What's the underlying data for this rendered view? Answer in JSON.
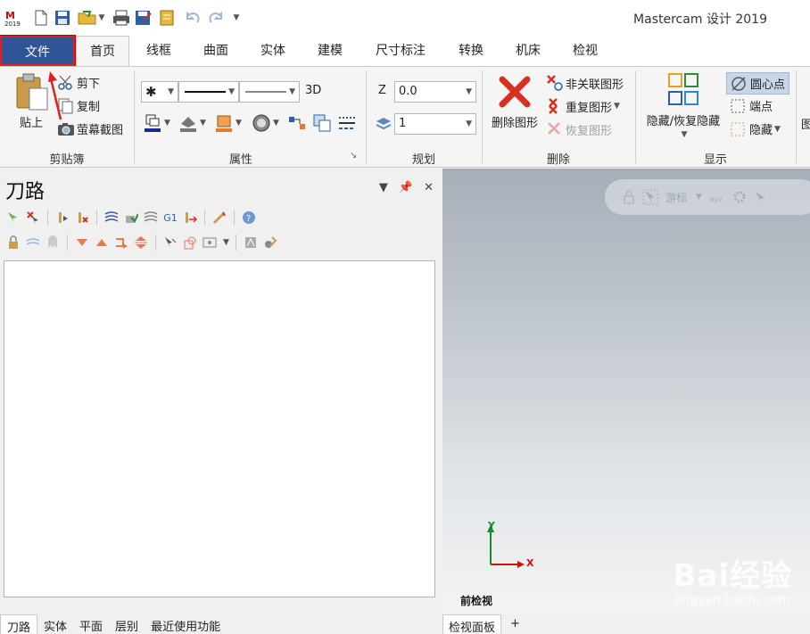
{
  "titlebar": {
    "app_logo_text": "2019",
    "app_title": "Mastercam 设计 2019"
  },
  "tabs": [
    {
      "label": "文件"
    },
    {
      "label": "首页"
    },
    {
      "label": "线框"
    },
    {
      "label": "曲面"
    },
    {
      "label": "实体"
    },
    {
      "label": "建模"
    },
    {
      "label": "尺寸标注"
    },
    {
      "label": "转换"
    },
    {
      "label": "机床"
    },
    {
      "label": "检视"
    }
  ],
  "ribbon": {
    "clipboard": {
      "paste": "贴上",
      "cut": "剪下",
      "copy": "复制",
      "screenshot": "萤幕截图",
      "group": "剪贴簿"
    },
    "attributes": {
      "dim_3d": "3D",
      "group": "属性"
    },
    "planning": {
      "z_label": "Z",
      "z_value": "0.0",
      "level_value": "1",
      "group": "规划"
    },
    "delete": {
      "delete_entities": "删除图形",
      "non_assoc": "非关联图形",
      "duplicate": "重复图形",
      "restore": "恢复图形",
      "group": "删除"
    },
    "display": {
      "hide_unhide": "隐藏/恢复隐藏",
      "arc_center": "圆心点",
      "endpoints": "端点",
      "hide": "隐藏",
      "group": "显示",
      "overflow": "图"
    }
  },
  "left_panel": {
    "title": "刀路",
    "toolbar_g1": "G1",
    "bottom_tabs": [
      "刀路",
      "实体",
      "平面",
      "层别",
      "最近使用功能"
    ]
  },
  "viewport": {
    "hud_label": "游标",
    "axis_y": "Y",
    "axis_x": "X",
    "view_label": "前检视",
    "tabs": [
      "检视面板",
      "+"
    ],
    "watermark": "Bai经验",
    "watermark_sub": "jingyan.baidu.com"
  },
  "colors": {
    "file_tab_bg": "#2f5597",
    "annotation_red": "#e02020",
    "delete_red": "#d83020",
    "axis_green": "#1a8a2a",
    "axis_red": "#cc1010"
  }
}
